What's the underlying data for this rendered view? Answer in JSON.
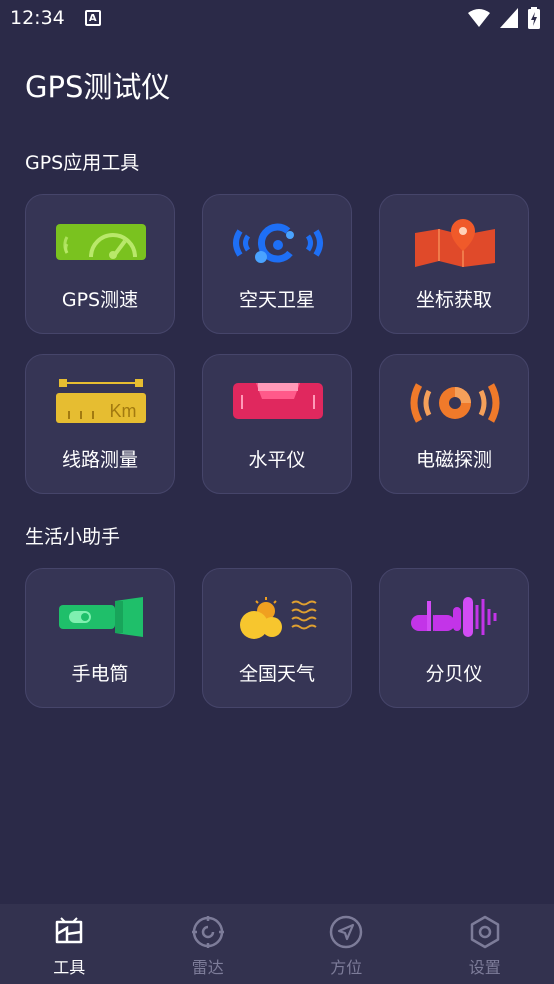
{
  "status": {
    "time": "12:34"
  },
  "app": {
    "title": "GPS测试仪"
  },
  "sections": [
    {
      "title": "GPS应用工具"
    },
    {
      "title": "生活小助手"
    }
  ],
  "tools": [
    {
      "label": "GPS测速",
      "icon": "speedometer-icon"
    },
    {
      "label": "空天卫星",
      "icon": "satellite-icon"
    },
    {
      "label": "坐标获取",
      "icon": "map-pin-icon"
    },
    {
      "label": "线路测量",
      "icon": "ruler-icon"
    },
    {
      "label": "水平仪",
      "icon": "level-icon"
    },
    {
      "label": "电磁探测",
      "icon": "em-detector-icon"
    }
  ],
  "helpers": [
    {
      "label": "手电筒",
      "icon": "flashlight-icon"
    },
    {
      "label": "全国天气",
      "icon": "weather-icon"
    },
    {
      "label": "分贝仪",
      "icon": "decibel-icon"
    }
  ],
  "nav": [
    {
      "label": "工具",
      "icon": "tools-icon",
      "active": true
    },
    {
      "label": "雷达",
      "icon": "radar-icon",
      "active": false
    },
    {
      "label": "方位",
      "icon": "compass-icon",
      "active": false
    },
    {
      "label": "设置",
      "icon": "settings-icon",
      "active": false
    }
  ],
  "colors": {
    "background": "#2b2a48",
    "tile": "#363555",
    "green": "#7ac21f",
    "blue": "#1e6ff5",
    "orange": "#f07a2a",
    "yellow": "#e6bd31",
    "pink": "#f0336e",
    "flashlight_green": "#1fbf6a",
    "purple": "#c334e8",
    "nav_inactive": "#7d7c99"
  },
  "ruler_text": "Km"
}
